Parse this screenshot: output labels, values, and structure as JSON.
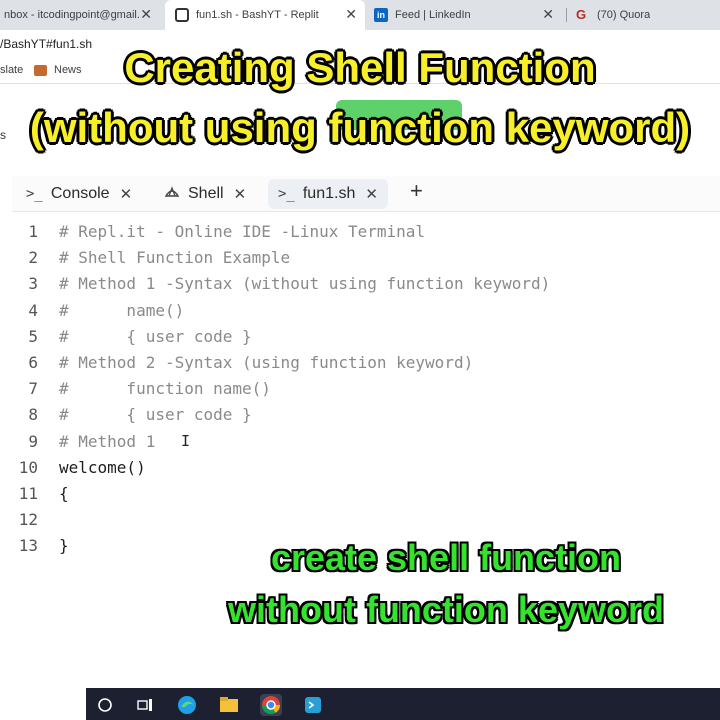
{
  "browser": {
    "tabs": [
      {
        "title": "nbox - itcodingpoint@gmail.con",
        "favicon": "gmail-icon",
        "active": false
      },
      {
        "title": "fun1.sh - BashYT - Replit",
        "favicon": "replit-icon",
        "active": true
      },
      {
        "title": "Feed | LinkedIn",
        "favicon": "linkedin-icon",
        "active": false
      },
      {
        "title": "(70) Quora",
        "favicon": "quora-icon",
        "active": false
      }
    ],
    "address": "/BashYT#fun1.sh",
    "bookmarks": [
      {
        "label": "slate"
      },
      {
        "label": "News"
      }
    ]
  },
  "captions": {
    "top_line1": "Creating Shell Function",
    "top_line2": "(without using function keyword)",
    "bottom_line1": "create shell function",
    "bottom_line2": "without function keyword"
  },
  "replit": {
    "side_label": "s",
    "tabs": [
      {
        "label": "Console",
        "icon": ">_",
        "active": false
      },
      {
        "label": "Shell",
        "icon": "shell-icon",
        "active": false
      },
      {
        "label": "fun1.sh",
        "icon": ">_",
        "active": true
      }
    ],
    "add_tab": "+"
  },
  "editor": {
    "lines": [
      {
        "no": "1",
        "text": "# Repl.it - Online IDE -Linux Terminal",
        "kind": "comment"
      },
      {
        "no": "2",
        "text": "# Shell Function Example",
        "kind": "comment"
      },
      {
        "no": "3",
        "text": "# Method 1 -Syntax (without using function keyword)",
        "kind": "comment"
      },
      {
        "no": "4",
        "text": "#      name()",
        "kind": "comment"
      },
      {
        "no": "5",
        "text": "#      { user code }",
        "kind": "comment"
      },
      {
        "no": "6",
        "text": "# Method 2 -Syntax (using function keyword)",
        "kind": "comment"
      },
      {
        "no": "7",
        "text": "#      function name()",
        "kind": "comment"
      },
      {
        "no": "8",
        "text": "#      { user code }",
        "kind": "comment"
      },
      {
        "no": "9",
        "text": "# Method 1",
        "kind": "comment"
      },
      {
        "no": "10",
        "text": "welcome()",
        "kind": "code"
      },
      {
        "no": "11",
        "text": "{",
        "kind": "code"
      },
      {
        "no": "12",
        "text": "",
        "kind": "code"
      },
      {
        "no": "13",
        "text": "}",
        "kind": "code"
      }
    ]
  },
  "colors": {
    "caption_yellow": "#f6ef2a",
    "caption_green": "#35e32f",
    "run_button_green": "#5ed16a",
    "taskbar": "#1c2030"
  }
}
